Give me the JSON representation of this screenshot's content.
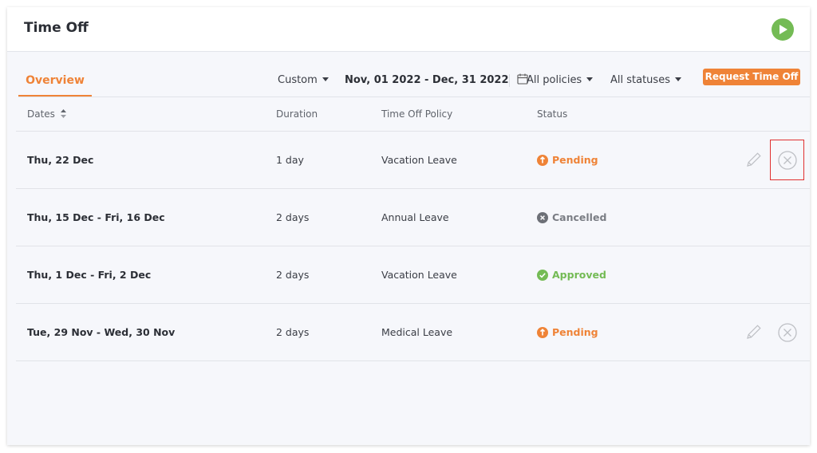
{
  "header": {
    "title": "Time Off",
    "play_icon": "play-icon"
  },
  "tabs": [
    {
      "label": "Overview",
      "active": true
    }
  ],
  "filters": {
    "range_type": "Custom",
    "date_range": "Nov, 01 2022 - Dec, 31 2022",
    "policy": "All policies",
    "status": "All statuses"
  },
  "actions": {
    "request_label": "Request Time Off"
  },
  "table": {
    "columns": [
      "Dates",
      "Duration",
      "Time Off Policy",
      "Status"
    ],
    "rows": [
      {
        "dates": "Thu, 22 Dec",
        "duration": "1 day",
        "policy": "Vacation Leave",
        "status": "Pending",
        "editable": true
      },
      {
        "dates": "Thu, 15 Dec - Fri, 16 Dec",
        "duration": "2 days",
        "policy": "Annual Leave",
        "status": "Cancelled",
        "editable": false
      },
      {
        "dates": "Thu, 1 Dec - Fri, 2 Dec",
        "duration": "2 days",
        "policy": "Vacation Leave",
        "status": "Approved",
        "editable": false
      },
      {
        "dates": "Tue, 29 Nov - Wed, 30 Nov",
        "duration": "2 days",
        "policy": "Medical Leave",
        "status": "Pending",
        "editable": true
      }
    ]
  },
  "colors": {
    "accent": "#ef8337",
    "pending": "#ef8337",
    "cancelled": "#7a7d84",
    "approved": "#74bb55",
    "play": "#74bb55",
    "highlight": "#e03030"
  }
}
